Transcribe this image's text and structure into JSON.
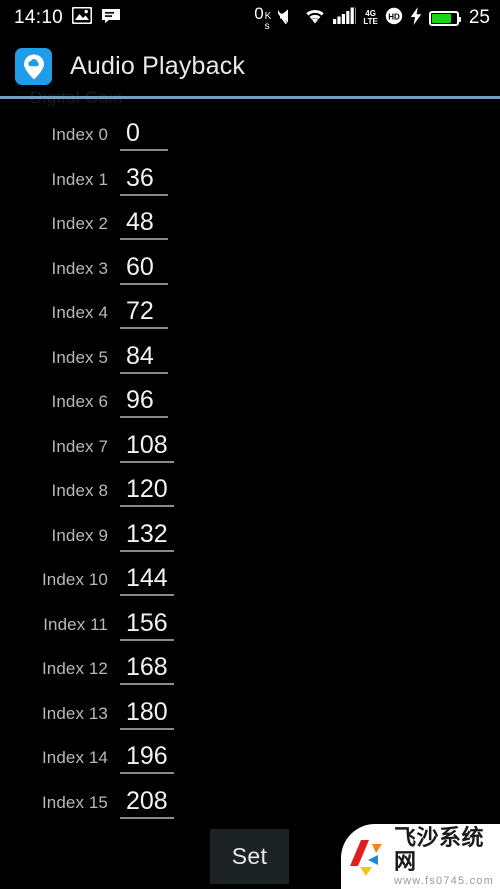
{
  "status_bar": {
    "clock": "14:10",
    "left_icons": [
      "photo-icon",
      "message-icon"
    ],
    "data_speed": "0",
    "data_speed_unit_top": "K",
    "data_speed_unit_bottom": "s",
    "right_icons": [
      "mute-icon",
      "wifi-icon",
      "signal-bars-icon",
      "4g-lte-icon",
      "hd-icon",
      "charging-bolt-icon"
    ],
    "network_tech_top": "4G",
    "network_tech_bottom": "LTE",
    "hd_label": "HD",
    "battery_percent": "25"
  },
  "app_bar": {
    "icon_name": "cloud-pin-icon",
    "icon_color": "#1f9de8",
    "title": "Audio Playback"
  },
  "divider_color": "#6f9fc4",
  "scrolled_off_label": "Digital Gain",
  "list": {
    "rows": [
      {
        "label": "Index 0",
        "value": "0"
      },
      {
        "label": "Index 1",
        "value": "36"
      },
      {
        "label": "Index 2",
        "value": "48"
      },
      {
        "label": "Index 3",
        "value": "60"
      },
      {
        "label": "Index 4",
        "value": "72"
      },
      {
        "label": "Index 5",
        "value": "84"
      },
      {
        "label": "Index 6",
        "value": "96"
      },
      {
        "label": "Index 7",
        "value": "108"
      },
      {
        "label": "Index 8",
        "value": "120"
      },
      {
        "label": "Index 9",
        "value": "132"
      },
      {
        "label": "Index 10",
        "value": "144"
      },
      {
        "label": "Index 11",
        "value": "156"
      },
      {
        "label": "Index 12",
        "value": "168"
      },
      {
        "label": "Index 13",
        "value": "180"
      },
      {
        "label": "Index 14",
        "value": "196"
      },
      {
        "label": "Index 15",
        "value": "208"
      }
    ]
  },
  "footer": {
    "set_button_label": "Set",
    "set_button_color": "#1d2225"
  },
  "watermark": {
    "brand_cn": "飞沙系统网",
    "url": "www.fs0745.com",
    "logo_colors": [
      "#e02020",
      "#f08519",
      "#1e87d6",
      "#f5c518"
    ]
  }
}
